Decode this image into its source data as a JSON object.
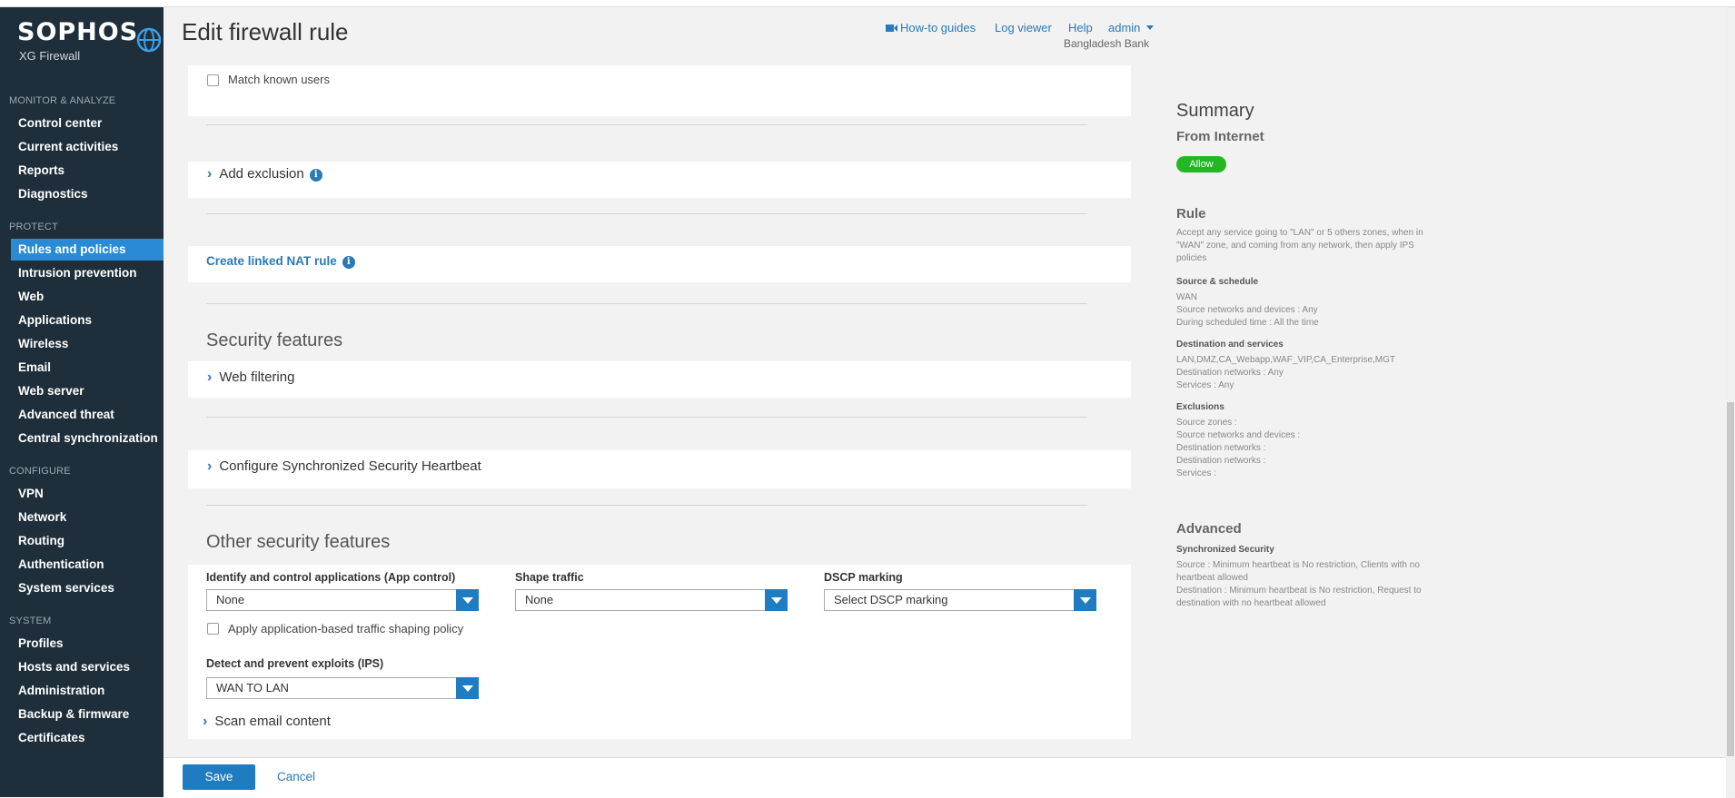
{
  "brand": {
    "name": "SOPHOS",
    "product": "XG Firewall"
  },
  "sidebar": {
    "sections": [
      {
        "label": "MONITOR & ANALYZE",
        "items": [
          "Control center",
          "Current activities",
          "Reports",
          "Diagnostics"
        ]
      },
      {
        "label": "PROTECT",
        "items": [
          "Rules and policies",
          "Intrusion prevention",
          "Web",
          "Applications",
          "Wireless",
          "Email",
          "Web server",
          "Advanced threat",
          "Central synchronization"
        ]
      },
      {
        "label": "CONFIGURE",
        "items": [
          "VPN",
          "Network",
          "Routing",
          "Authentication",
          "System services"
        ]
      },
      {
        "label": "SYSTEM",
        "items": [
          "Profiles",
          "Hosts and services",
          "Administration",
          "Backup & firmware",
          "Certificates"
        ]
      }
    ],
    "active_item": "Rules and policies"
  },
  "header": {
    "title": "Edit firewall rule",
    "howto": "How-to guides",
    "logviewer": "Log viewer",
    "help": "Help",
    "user": "admin",
    "org": "Bangladesh Bank"
  },
  "form": {
    "match_known_users": "Match known users",
    "add_exclusion": "Add exclusion",
    "create_nat": "Create linked NAT rule",
    "security_features_title": "Security features",
    "web_filtering": "Web filtering",
    "heartbeat": "Configure Synchronized Security Heartbeat",
    "other_title": "Other security features",
    "app_control_label": "Identify and control applications (App control)",
    "app_control_value": "None",
    "shape_label": "Shape traffic",
    "shape_value": "None",
    "dscp_label": "DSCP marking",
    "dscp_value": "Select DSCP marking",
    "apply_shaping": "Apply application-based traffic shaping policy",
    "ips_label": "Detect and prevent exploits (IPS)",
    "ips_value": "WAN TO LAN",
    "scan_email": "Scan email content"
  },
  "footer": {
    "save": "Save",
    "cancel": "Cancel"
  },
  "summary": {
    "title": "Summary",
    "rule_name": "From Internet",
    "action_badge": "Allow",
    "rule_heading": "Rule",
    "rule_desc": "Accept any service going to \"LAN\" or 5 others zones, when in \"WAN\" zone, and coming from any network, then apply IPS policies",
    "source_heading": "Source & schedule",
    "source_lines": [
      "WAN",
      "Source networks and devices : Any",
      "During scheduled time : All the time"
    ],
    "dest_heading": "Destination and services",
    "dest_lines": [
      "LAN,DMZ,CA_Webapp,WAF_VIP,CA_Enterprise,MGT",
      "Destination networks : Any",
      "Services : Any"
    ],
    "excl_heading": "Exclusions",
    "excl_lines": [
      "Source zones :",
      "Source networks and devices :",
      "Destination networks :",
      "Destination networks :",
      "Services :"
    ],
    "advanced_heading": "Advanced",
    "sync_heading": "Synchronized Security",
    "sync_lines": [
      "Source : Minimum heartbeat is No restriction, Clients with no heartbeat allowed",
      "Destination : Minimum heartbeat is No restriction, Request to destination with no heartbeat allowed"
    ]
  },
  "colors": {
    "sidebar_bg": "#1e2f3b",
    "accent": "#2a8bd4",
    "allow_badge": "#23b723"
  }
}
